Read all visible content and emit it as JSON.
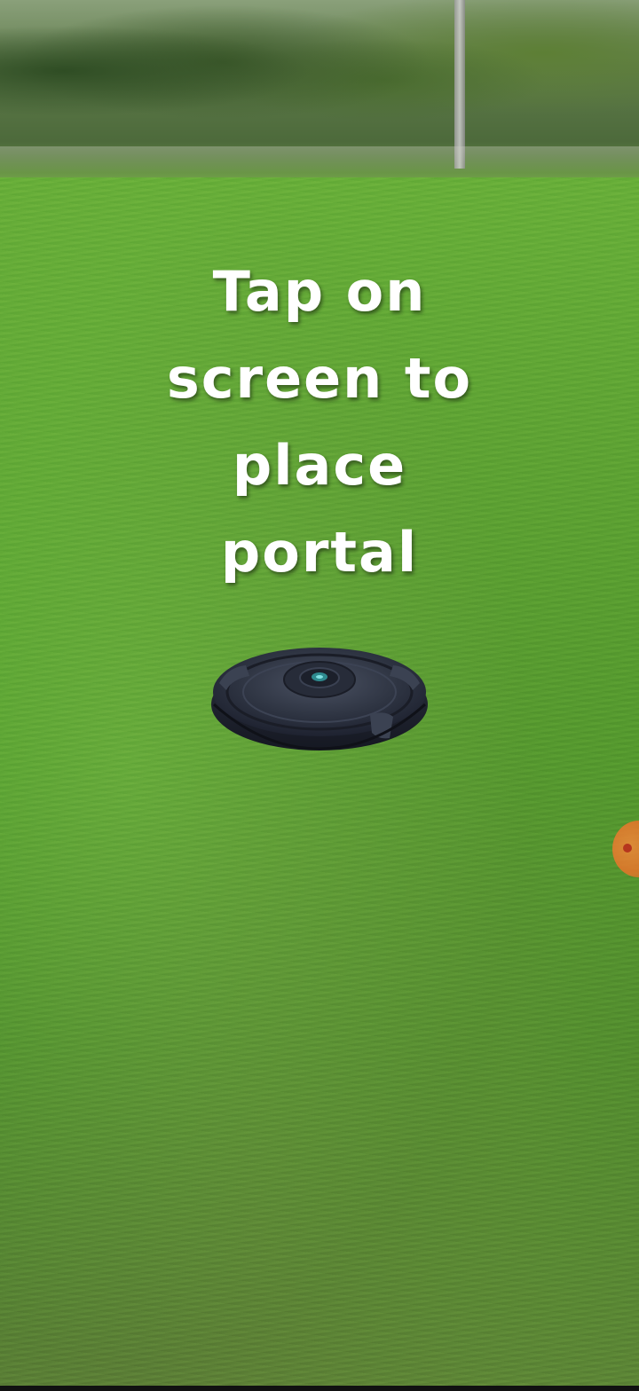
{
  "ar_view": {
    "instruction_lines": [
      "Tap on",
      "screen to",
      "place",
      "portal"
    ]
  },
  "portal": {
    "icon": "portal-disc-icon",
    "color": "#2a2f3a"
  },
  "edge_indicator": {
    "icon": "offscreen-marker-icon",
    "color": "#e9742a"
  }
}
